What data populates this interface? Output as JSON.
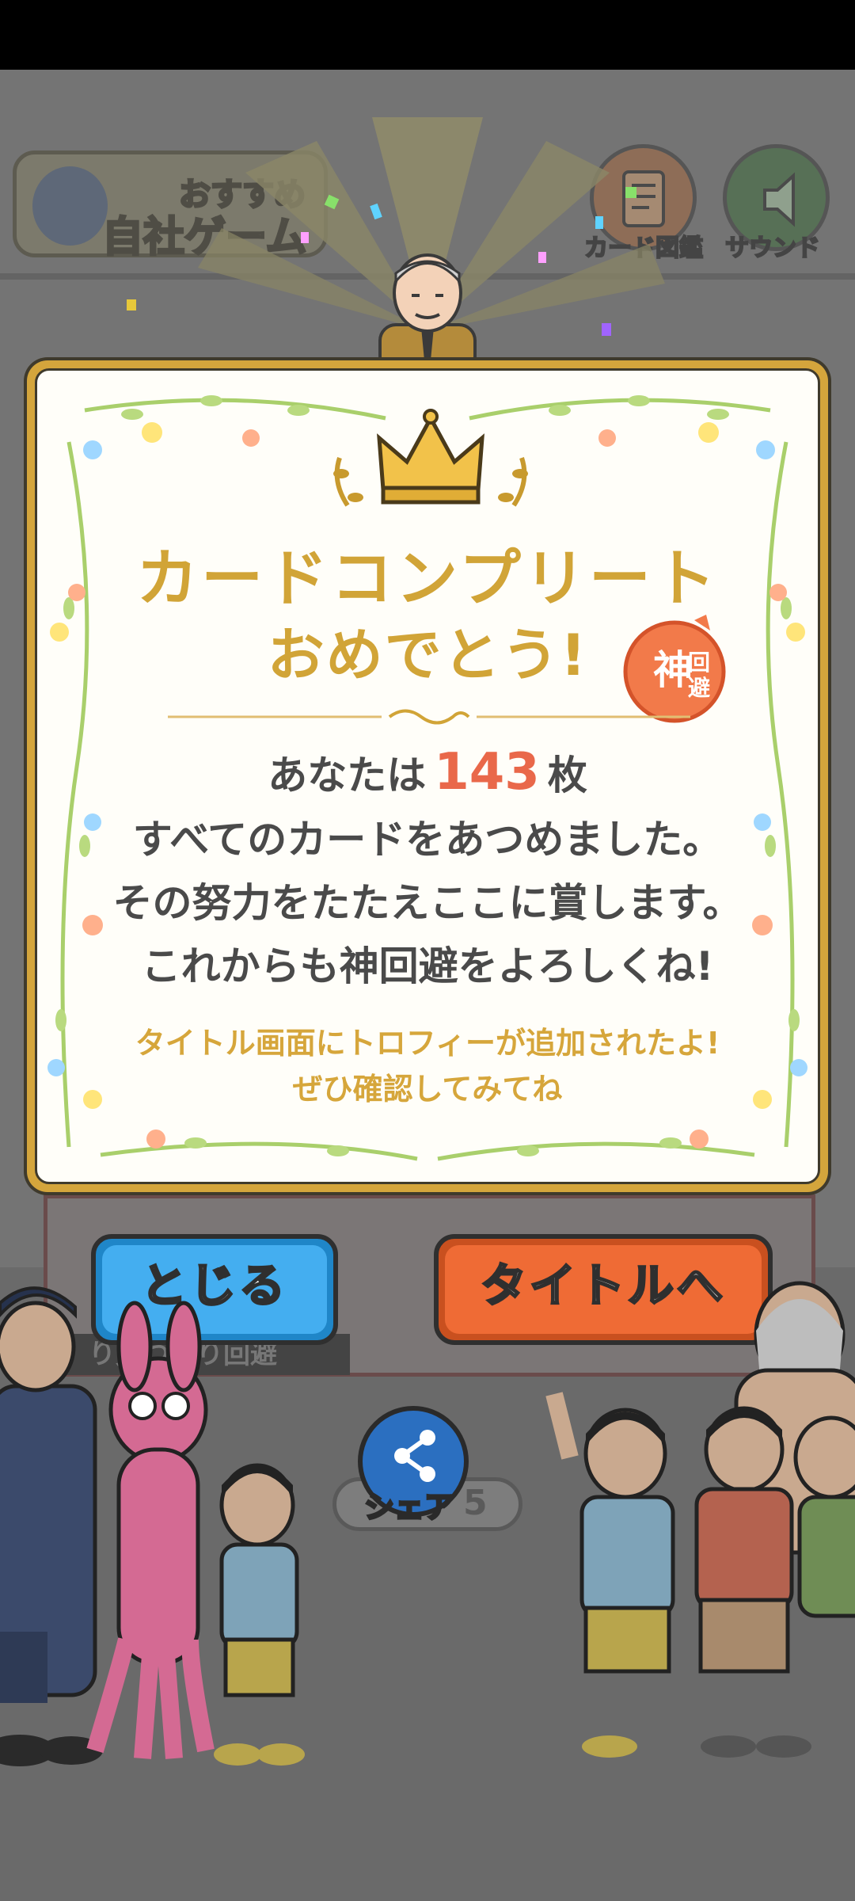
{
  "background_ui": {
    "promo_banner": {
      "line1": "おすすめ",
      "line2": "自社ゲーム"
    },
    "card_button_label": "カード図鑑",
    "sound_button_label": "サウンド",
    "caption": "り見つかり回避",
    "pill_number": "5"
  },
  "dialog": {
    "title_line1": "カードコンプリート",
    "title_line2": "おめでとう!",
    "stamp_text": "神回避",
    "message": {
      "prefix": "あなたは",
      "count": "143",
      "suffix": "枚",
      "line2": "すべてのカードをあつめました。",
      "line3": "その努力をたたえここに賞します。",
      "line4": "これからも神回避をよろしくね!"
    },
    "note_line1": "タイトル画面にトロフィーが追加されたよ!",
    "note_line2": "ぜひ確認してみてね"
  },
  "buttons": {
    "close_label": "とじる",
    "title_label": "タイトルへ",
    "share_label": "シェア"
  },
  "colors": {
    "gold": "#d1a437",
    "accent_orange": "#e9684a",
    "close_blue": "#44aef0",
    "title_orange": "#ef6b35",
    "share_blue": "#2b6fc0"
  }
}
